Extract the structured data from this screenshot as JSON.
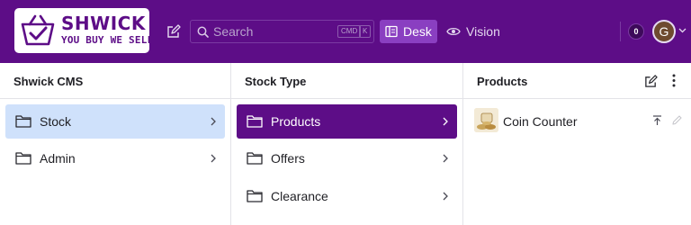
{
  "brand": {
    "name": "SHWICK",
    "tagline": "YOU BUY WE SELL",
    "color": "#5d0d87"
  },
  "topbar": {
    "search": {
      "placeholder": "Search",
      "shortcut_keys": [
        "CMD",
        "K"
      ]
    },
    "tools": [
      {
        "label": "Desk",
        "icon": "desk-icon",
        "active": true
      },
      {
        "label": "Vision",
        "icon": "eye-icon",
        "active": false
      }
    ],
    "notification_count": "0",
    "avatar_initial": "G"
  },
  "panes": [
    {
      "title": "Shwick CMS",
      "items": [
        {
          "label": "Stock",
          "icon": "folder-icon",
          "selected": true
        },
        {
          "label": "Admin",
          "icon": "folder-icon",
          "selected": false
        }
      ]
    },
    {
      "title": "Stock Type",
      "items": [
        {
          "label": "Products",
          "icon": "folder-icon",
          "selected": true
        },
        {
          "label": "Offers",
          "icon": "folder-icon",
          "selected": false
        },
        {
          "label": "Clearance",
          "icon": "folder-icon",
          "selected": false
        }
      ]
    },
    {
      "title": "Products",
      "items": [
        {
          "label": "Coin Counter",
          "icon": "product-thumbnail"
        }
      ]
    }
  ],
  "colors": {
    "topbar": "#5d0d87",
    "active_tool": "#8a3fc1",
    "selected_dark": "#5d0d87",
    "selected_light": "#cfe1fb"
  }
}
